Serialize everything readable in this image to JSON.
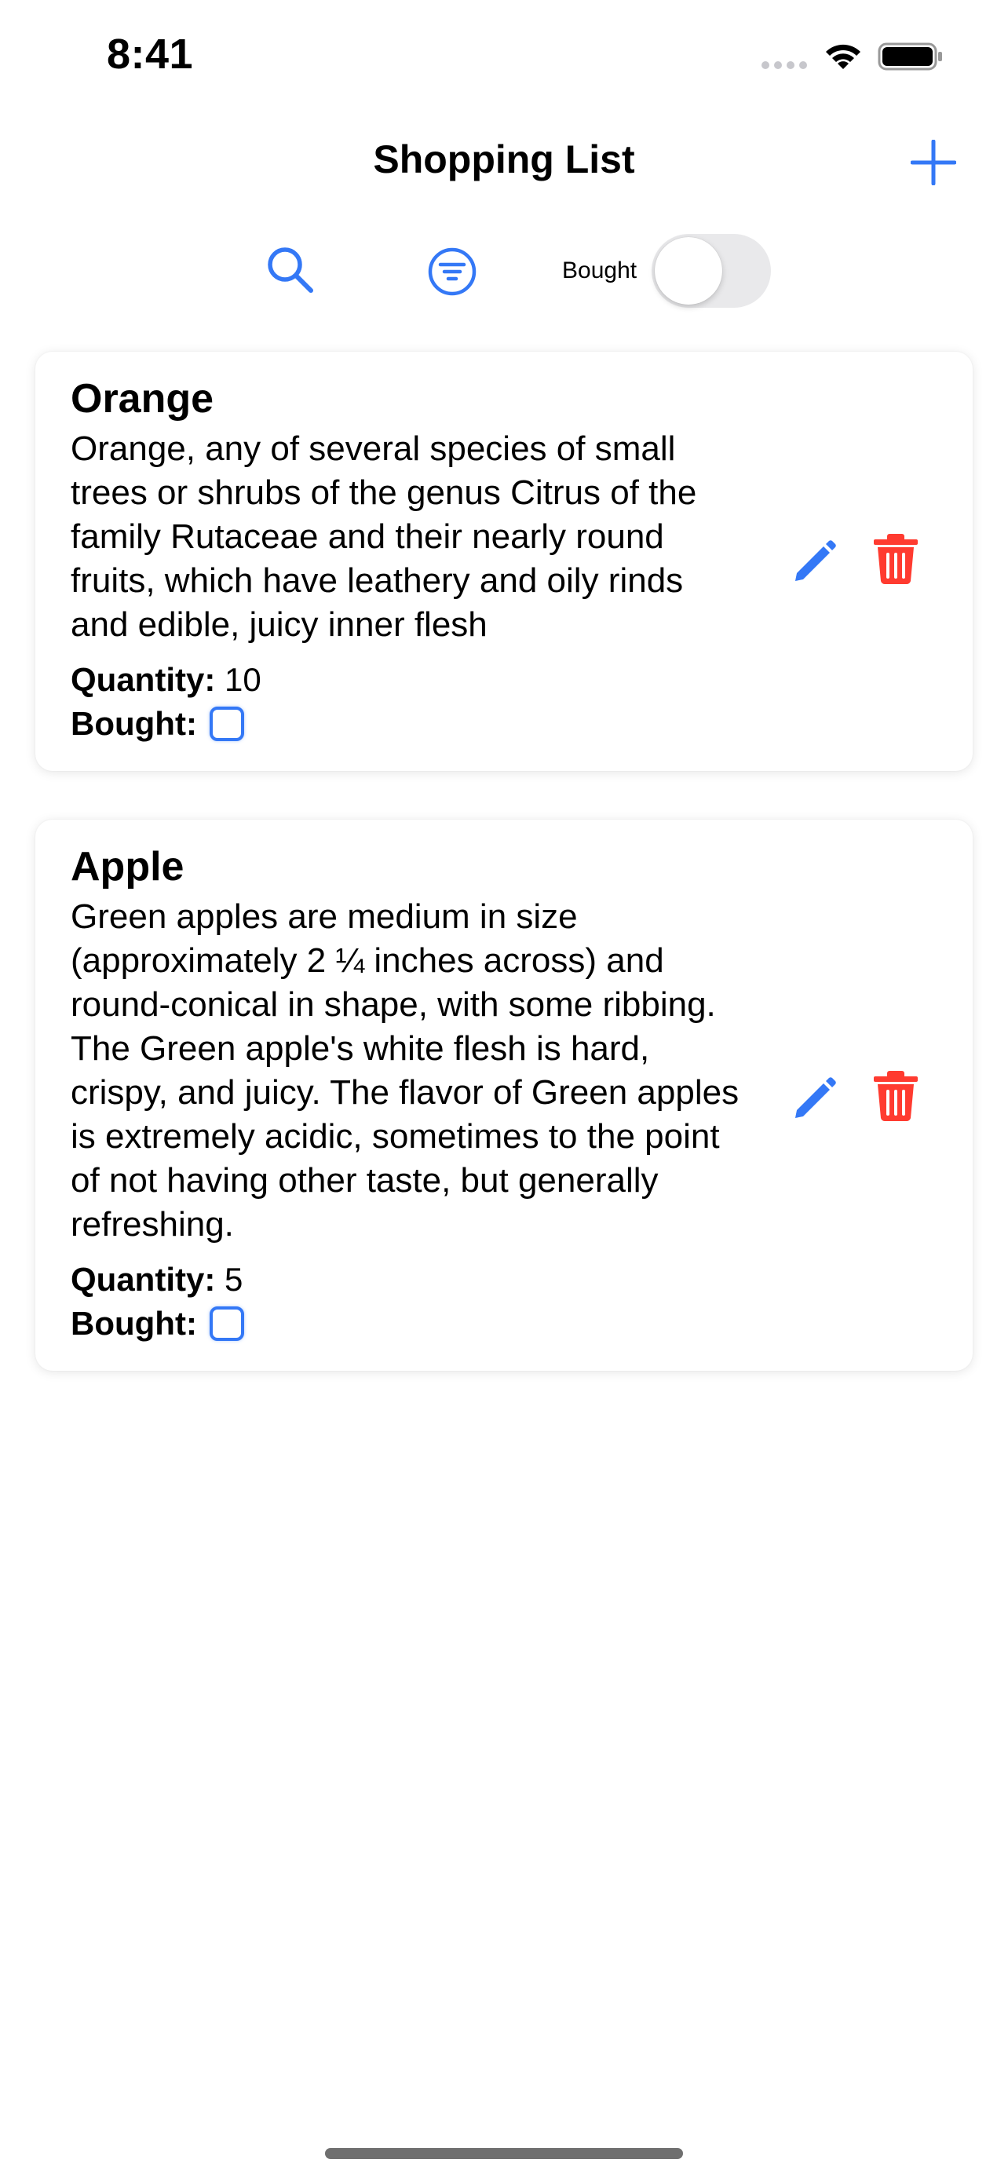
{
  "status_bar": {
    "time": "8:41"
  },
  "nav": {
    "title": "Shopping List",
    "add_icon": "plus-icon"
  },
  "toolbar": {
    "search_icon": "magnifying-glass-icon",
    "filter_icon": "filter-lines-icon",
    "bought_toggle_label": "Bought",
    "bought_toggle_on": false
  },
  "items": [
    {
      "title": "Orange",
      "description": "Orange, any of several species of small trees or shrubs of the genus Citrus of the family Rutaceae and their nearly round fruits, which have leathery and oily rinds and edible, juicy inner flesh",
      "quantity_label": "Quantity:",
      "quantity": "10",
      "bought_label": "Bought:",
      "bought": false
    },
    {
      "title": "Apple",
      "description": "Green apples are medium in size (approximately 2 ¼ inches across) and round-conical in shape, with some ribbing. The Green apple's white flesh is hard, crispy, and juicy. The flavor of Green apples is extremely acidic, sometimes to the point of not having other taste, but generally refreshing.",
      "quantity_label": "Quantity:",
      "quantity": "5",
      "bought_label": "Bought:",
      "bought": false
    }
  ],
  "colors": {
    "accent": "#3478f6",
    "delete": "#ff3b30",
    "toggle_off": "#e9e9eb"
  }
}
